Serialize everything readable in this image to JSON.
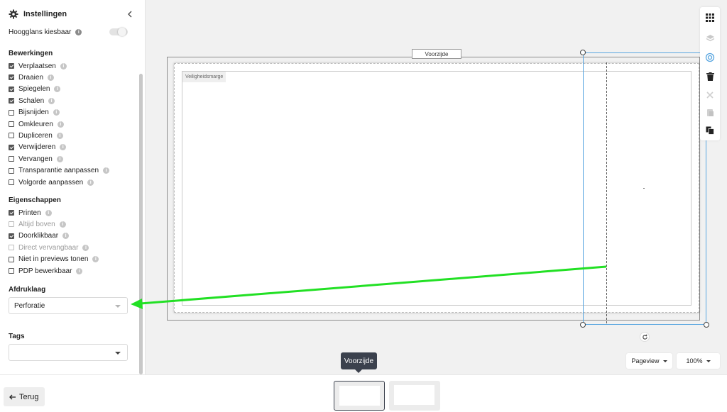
{
  "sidebar": {
    "title": "Instellingen",
    "hoogglans_label": "Hoogglans kiesbaar",
    "sections": {
      "bewerkingen": "Bewerkingen",
      "eigenschappen": "Eigenschappen",
      "afdruklaag": "Afdruklaag",
      "tags": "Tags"
    },
    "bewerkingen": [
      {
        "label": "Verplaatsen",
        "checked": true
      },
      {
        "label": "Draaien",
        "checked": true
      },
      {
        "label": "Spiegelen",
        "checked": true
      },
      {
        "label": "Schalen",
        "checked": true
      },
      {
        "label": "Bijsnijden",
        "checked": false
      },
      {
        "label": "Omkleuren",
        "checked": false
      },
      {
        "label": "Dupliceren",
        "checked": false
      },
      {
        "label": "Verwijderen",
        "checked": true
      },
      {
        "label": "Vervangen",
        "checked": false
      },
      {
        "label": "Transparantie aanpassen",
        "checked": false
      },
      {
        "label": "Volgorde aanpassen",
        "checked": false
      }
    ],
    "eigenschappen": [
      {
        "label": "Printen",
        "checked": true,
        "disabled": false
      },
      {
        "label": "Altijd boven",
        "checked": false,
        "disabled": true
      },
      {
        "label": "Doorklikbaar",
        "checked": true,
        "disabled": false
      },
      {
        "label": "Direct vervangbaar",
        "checked": false,
        "disabled": true
      },
      {
        "label": "Niet in previews tonen",
        "checked": false,
        "disabled": false
      },
      {
        "label": "PDP bewerkbaar",
        "checked": false,
        "disabled": false
      }
    ],
    "afdruklaag_value": "Perforatie",
    "tags_value": ""
  },
  "canvas": {
    "face_label": "Voorzijde",
    "safe_margin_label": "Veiligheidsmarge"
  },
  "controls": {
    "pageview_label": "Pageview",
    "zoom_label": "100%"
  },
  "tooltip": "Voorzijde",
  "bottom": {
    "back_label": "Terug"
  },
  "icons": {
    "header": "gear-icon",
    "collapse": "chevron-left-icon",
    "toolbar": [
      "grid-icon",
      "layers-icon",
      "focus-icon",
      "trash-icon",
      "cut-icon",
      "paste-icon",
      "copy-icon"
    ],
    "rotate": "rotate-icon",
    "back": "arrow-left-icon"
  },
  "colors": {
    "selection": "#59a6e0",
    "annotation_arrow": "#22e024",
    "tooltip_bg": "#3b414d"
  }
}
